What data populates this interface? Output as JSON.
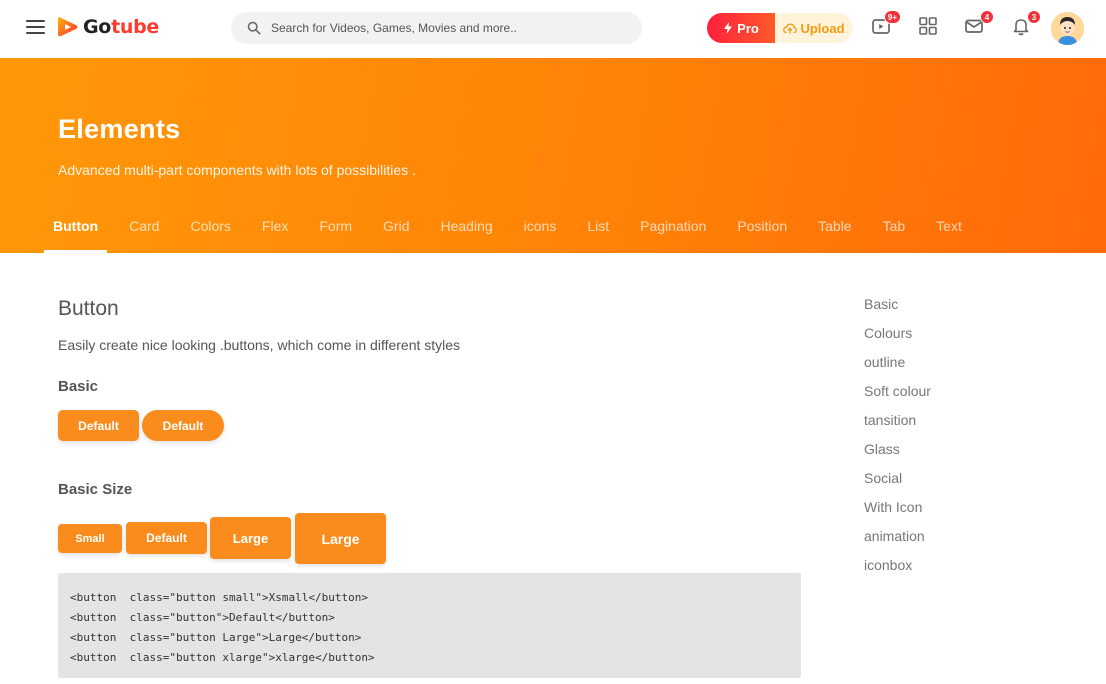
{
  "header": {
    "logo_text_a": "Go",
    "logo_text_b": "tube",
    "search_placeholder": "Search for Videos, Games, Movies and more..",
    "pro_label": "Pro",
    "upload_label": "Upload",
    "video_badge": "9+",
    "mail_badge": "4",
    "bell_badge": "3"
  },
  "hero": {
    "title": "Elements",
    "subtitle": "Advanced multi-part components with lots of possibilities .",
    "tabs": [
      "Button",
      "Card",
      "Colors",
      "Flex",
      "Form",
      "Grid",
      "Heading",
      "icons",
      "List",
      "Pagination",
      "Position",
      "Table",
      "Tab",
      "Text"
    ]
  },
  "main": {
    "title": "Button",
    "description": "Easily create nice looking .buttons, which come in different styles",
    "basic_title": "Basic",
    "basic_buttons": [
      "Default",
      "Default"
    ],
    "size_title": "Basic Size",
    "size_buttons": [
      "Small",
      "Default",
      "Large",
      "Large"
    ],
    "code_lines": [
      "<button  class=\"button small\">Xsmall</button>",
      "<button  class=\"button\">Default</button>",
      "<button  class=\"button Large\">Large</button>",
      "<button  class=\"button xlarge\">xlarge</button>"
    ]
  },
  "right_nav": [
    "Basic",
    "Colours",
    "outline",
    "Soft colour",
    "tansition",
    "Glass",
    "Social",
    "With Icon",
    "animation",
    "iconbox"
  ],
  "colors": {
    "accent": "#f98c1d",
    "hero_start": "#ff9808",
    "hero_end": "#ff6a08",
    "badge": "#f0323a"
  }
}
